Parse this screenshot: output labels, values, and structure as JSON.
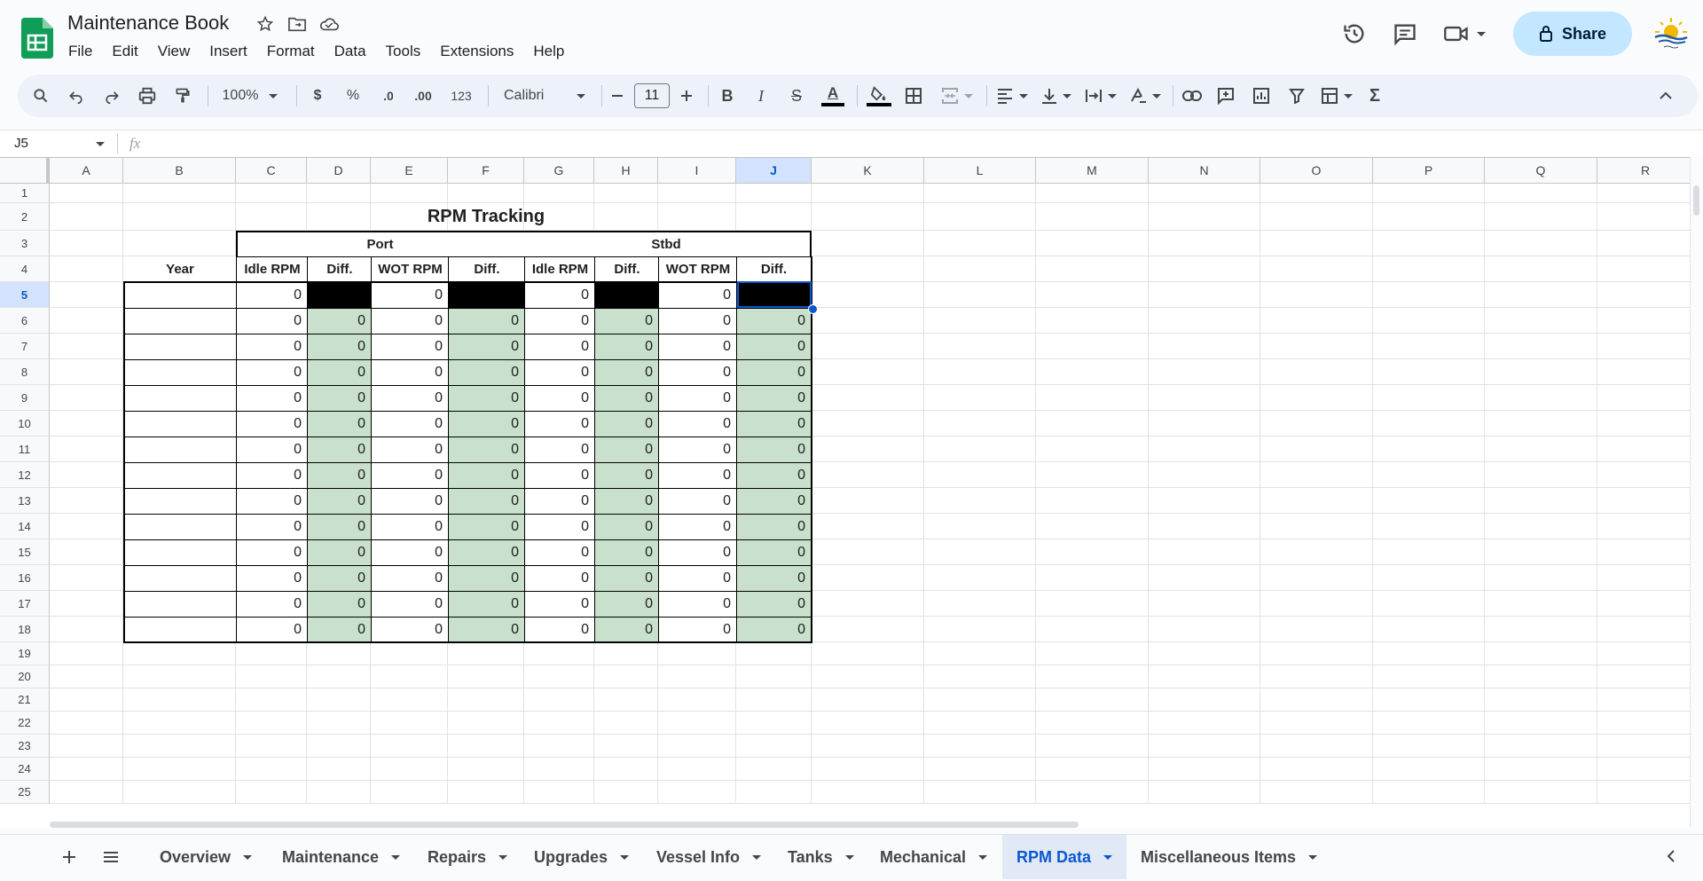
{
  "app": {
    "doc_title": "Maintenance Book",
    "menu": [
      "File",
      "Edit",
      "View",
      "Insert",
      "Format",
      "Data",
      "Tools",
      "Extensions",
      "Help"
    ],
    "share_label": "Share"
  },
  "toolbar": {
    "zoom": "100%",
    "currency": "$",
    "percent": "%",
    "dec_decrease": ".0",
    "dec_increase": ".00",
    "number_format": "123",
    "font": "Calibri",
    "font_size": "11",
    "bold": "B",
    "italic": "I",
    "strike": "S",
    "text_color": "A",
    "sum": "Σ"
  },
  "formula_bar": {
    "name_box": "J5",
    "fx": "fx"
  },
  "grid": {
    "columns": [
      "A",
      "B",
      "C",
      "D",
      "E",
      "F",
      "G",
      "H",
      "I",
      "J",
      "K",
      "L",
      "M",
      "N",
      "O",
      "P",
      "Q",
      "R"
    ],
    "rows": [
      "1",
      "2",
      "3",
      "4",
      "5",
      "6",
      "7",
      "8",
      "9",
      "10",
      "11",
      "12",
      "13",
      "14",
      "15",
      "16",
      "17",
      "18",
      "19",
      "20",
      "21",
      "22",
      "23",
      "24",
      "25"
    ],
    "selected_cell": "J5"
  },
  "sheet": {
    "title": "RPM Tracking",
    "group_port": "Port",
    "group_stbd": "Stbd",
    "headers": [
      "Year",
      "Idle RPM",
      "Diff.",
      "WOT RPM",
      "Diff.",
      "Idle RPM",
      "Diff.",
      "WOT RPM",
      "Diff."
    ],
    "first_row": [
      "",
      "0",
      "",
      "0",
      "",
      "0",
      "",
      "0",
      ""
    ],
    "data_rows": [
      [
        "",
        "0",
        "0",
        "0",
        "0",
        "0",
        "0",
        "0",
        "0"
      ],
      [
        "",
        "0",
        "0",
        "0",
        "0",
        "0",
        "0",
        "0",
        "0"
      ],
      [
        "",
        "0",
        "0",
        "0",
        "0",
        "0",
        "0",
        "0",
        "0"
      ],
      [
        "",
        "0",
        "0",
        "0",
        "0",
        "0",
        "0",
        "0",
        "0"
      ],
      [
        "",
        "0",
        "0",
        "0",
        "0",
        "0",
        "0",
        "0",
        "0"
      ],
      [
        "",
        "0",
        "0",
        "0",
        "0",
        "0",
        "0",
        "0",
        "0"
      ],
      [
        "",
        "0",
        "0",
        "0",
        "0",
        "0",
        "0",
        "0",
        "0"
      ],
      [
        "",
        "0",
        "0",
        "0",
        "0",
        "0",
        "0",
        "0",
        "0"
      ],
      [
        "",
        "0",
        "0",
        "0",
        "0",
        "0",
        "0",
        "0",
        "0"
      ],
      [
        "",
        "0",
        "0",
        "0",
        "0",
        "0",
        "0",
        "0",
        "0"
      ],
      [
        "",
        "0",
        "0",
        "0",
        "0",
        "0",
        "0",
        "0",
        "0"
      ],
      [
        "",
        "0",
        "0",
        "0",
        "0",
        "0",
        "0",
        "0",
        "0"
      ],
      [
        "",
        "0",
        "0",
        "0",
        "0",
        "0",
        "0",
        "0",
        "0"
      ]
    ]
  },
  "tabs": [
    {
      "label": "Overview",
      "active": false
    },
    {
      "label": "Maintenance",
      "active": false
    },
    {
      "label": "Repairs",
      "active": false
    },
    {
      "label": "Upgrades",
      "active": false
    },
    {
      "label": "Vessel Info",
      "active": false
    },
    {
      "label": "Tanks",
      "active": false
    },
    {
      "label": "Mechanical",
      "active": false
    },
    {
      "label": "RPM Data",
      "active": true
    },
    {
      "label": "Miscellaneous Items",
      "active": false
    }
  ],
  "colors": {
    "accent": "#0b57d0",
    "diff_fill": "#c9e0cc",
    "share_bg": "#c2e7ff"
  }
}
